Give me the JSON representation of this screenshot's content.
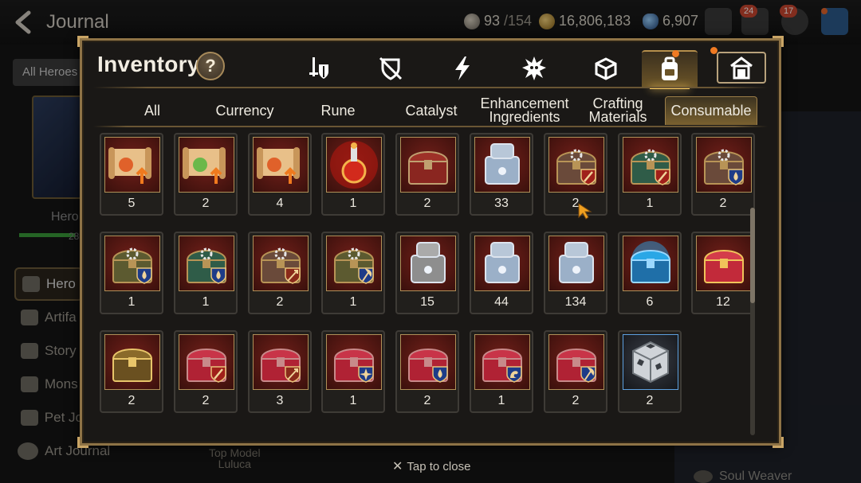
{
  "header": {
    "title": "Journal",
    "stamina": "93",
    "stamina_max": "/154",
    "gold": "16,806,183",
    "skystones": "6,907",
    "mail_badge": "24",
    "chat_badge": "17"
  },
  "sidebar": {
    "all_heroes": "All Heroes",
    "hero_label": "Hero",
    "hero_bar_num": "28",
    "items": [
      {
        "label": "Hero",
        "icon": "hero-icon"
      },
      {
        "label": "Artifa",
        "icon": "artifact-icon"
      },
      {
        "label": "Story",
        "icon": "story-icon"
      },
      {
        "label": "Mons",
        "icon": "monster-icon"
      },
      {
        "label": "Pet Jo",
        "icon": "pet-icon"
      }
    ],
    "art_journal": "Art Journal"
  },
  "background": {
    "top_model_line1": "Top Model",
    "top_model_line2": "Luluca",
    "soul_weaver": "Soul Weaver"
  },
  "modal": {
    "title": "Inventory",
    "help": "?",
    "category_tabs": [
      {
        "icon": "weapon-armor-icon",
        "active": false
      },
      {
        "icon": "crossed-shield-icon",
        "active": false
      },
      {
        "icon": "lightning-icon",
        "active": false
      },
      {
        "icon": "spiky-blob-icon",
        "active": false
      },
      {
        "icon": "cube-icon",
        "active": false
      },
      {
        "icon": "backpack-icon",
        "active": true
      }
    ],
    "storage_icon": "storage-house-icon",
    "sub_tabs": [
      {
        "label": "All"
      },
      {
        "label": "Currency"
      },
      {
        "label": "Rune"
      },
      {
        "label": "Catalyst"
      },
      {
        "label": "Enhancement Ingredients"
      },
      {
        "label": "Crafting Materials"
      },
      {
        "label": "Consumable",
        "active": true
      }
    ],
    "items": [
      {
        "kind": "scroll-orange",
        "count": "5"
      },
      {
        "kind": "scroll-rainbow",
        "count": "2"
      },
      {
        "kind": "scroll-orange",
        "count": "4"
      },
      {
        "kind": "potion",
        "count": "1"
      },
      {
        "kind": "red-chest",
        "count": "2"
      },
      {
        "kind": "silver-box",
        "count": "33"
      },
      {
        "kind": "gear-chest-sword",
        "count": "2"
      },
      {
        "kind": "green-gear-chest-sword",
        "count": "1"
      },
      {
        "kind": "gear-chest-water",
        "count": "2"
      },
      {
        "kind": "olive-gear-chest-water",
        "count": "1"
      },
      {
        "kind": "green-gear-chest-water",
        "count": "1"
      },
      {
        "kind": "gear-chest-arrow",
        "count": "2"
      },
      {
        "kind": "olive-gear-chest-axe",
        "count": "1"
      },
      {
        "kind": "grey-box",
        "count": "15"
      },
      {
        "kind": "silver-box",
        "count": "44"
      },
      {
        "kind": "silver-box",
        "count": "134"
      },
      {
        "kind": "blue-glow-chest",
        "count": "6"
      },
      {
        "kind": "red-gold-chest",
        "count": "12"
      },
      {
        "kind": "golden-chest",
        "count": "2"
      },
      {
        "kind": "red-chest-sword",
        "count": "2"
      },
      {
        "kind": "red-chest-arrow",
        "count": "3"
      },
      {
        "kind": "red-chest-star",
        "count": "1"
      },
      {
        "kind": "red-chest-water",
        "count": "2"
      },
      {
        "kind": "red-chest-arm",
        "count": "1"
      },
      {
        "kind": "red-chest-axe",
        "count": "2"
      },
      {
        "kind": "silver-cube",
        "count": "2"
      }
    ],
    "close_hint": "Tap to close"
  }
}
